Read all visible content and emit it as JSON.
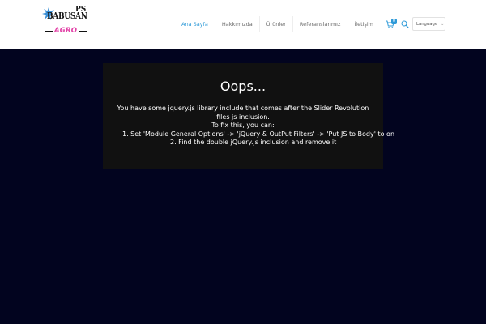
{
  "header": {
    "logo": {
      "brand": "BABUSAN",
      "brand_suffix": "PS",
      "sub": "AGRO"
    },
    "nav": [
      {
        "label": "Ana Sayfa",
        "active": true
      },
      {
        "label": "Hakkımızda",
        "active": false
      },
      {
        "label": "Ürünler",
        "active": false
      },
      {
        "label": "Referanslarımız",
        "active": false
      },
      {
        "label": "İletişim",
        "active": false
      }
    ],
    "cart": {
      "icon": "cart-icon",
      "count": "0"
    },
    "search": {
      "icon": "search-icon"
    },
    "language": {
      "label": "Language",
      "icon": "chevron-down-icon"
    }
  },
  "error": {
    "title": "Oops...",
    "line1": "You have some jquery.js library include that comes after the Slider Revolution files js inclusion.",
    "line2": "To fix this, you can:",
    "line3": "1. Set 'Module General Options' -> 'jQuery & OutPut Filters' -> 'Put JS to Body' to on",
    "line4": "2. Find the double jQuery.js inclusion and remove it"
  },
  "colors": {
    "accent": "#2e9ad8",
    "background": "#02041f",
    "error_box": "#111111",
    "logo_pink": "#e23fa6"
  }
}
